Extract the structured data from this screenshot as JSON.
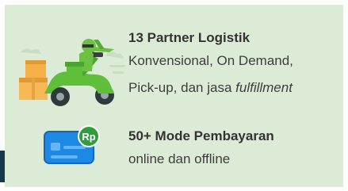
{
  "features": [
    {
      "title": "13 Partner Logistik",
      "desc_line1": "Konvensional, On Demand,",
      "desc_line2_prefix": "Pick-up, dan jasa ",
      "desc_line2_italic": "fulfillment",
      "icon": "delivery-scooter-icon"
    },
    {
      "title": "50+ Mode Pembayaran",
      "desc_line1": "online dan offline",
      "icon": "payment-card-icon",
      "badge_text": "Rp"
    }
  ],
  "colors": {
    "card_bg": "#dcebd6",
    "scooter_green": "#5fbf3a",
    "card_blue": "#1e88e5",
    "badge_green": "#2e9e3e"
  }
}
